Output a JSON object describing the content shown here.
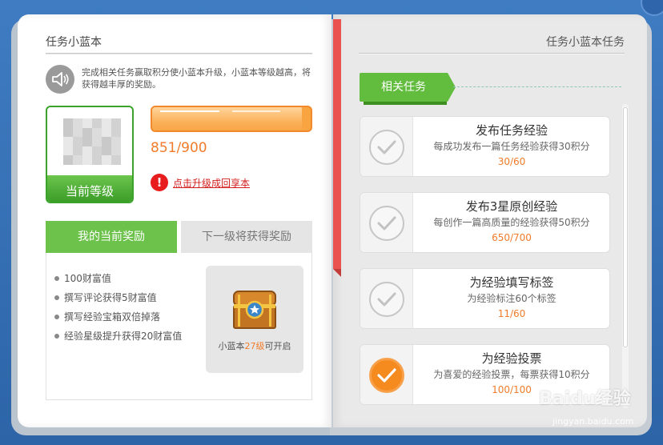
{
  "left": {
    "title": "任务小蓝本",
    "intro": "完成相关任务赢取积分使小蓝本升级，小蓝本等级越高，将获得越丰厚的奖励。",
    "level_label": "当前等级",
    "progress_text": "851/900",
    "progress_fraction": 0.945,
    "upgrade_link": "点击升级成回享本",
    "tabs": [
      {
        "label": "我的当前奖励",
        "active": true
      },
      {
        "label": "下一级将获得奖励",
        "active": false
      }
    ],
    "rewards": [
      "100财富值",
      "撰写评论获得5财富值",
      "撰写经验宝箱双倍掉落",
      "经验星级提升获得20财富值"
    ],
    "chest": {
      "prefix": "小蓝本",
      "level": "27级",
      "suffix": "可开启"
    }
  },
  "right": {
    "title": "任务小蓝本任务",
    "section_tag": "相关任务",
    "tasks": [
      {
        "title": "发布任务经验",
        "desc": "每成功发布一篇任务经验获得30积分",
        "progress": "30/60",
        "done": false
      },
      {
        "title": "发布3星原创经验",
        "desc": "每创作一篇高质量的经验获得50积分",
        "progress": "650/700",
        "done": false
      },
      {
        "title": "为经验填写标签",
        "desc": "为经验标注60个标签",
        "progress": "11/60",
        "done": false
      },
      {
        "title": "为经验投票",
        "desc": "为喜爱的经验投票，每票获得10积分",
        "progress": "100/100",
        "done": true
      }
    ]
  },
  "watermark": {
    "text": "Baidu经验",
    "url": "jingyan.baidu.com"
  },
  "colors": {
    "green": "#6dc24b",
    "orange": "#f07b2a",
    "red": "#e9524f",
    "blue": "#2e63a6"
  }
}
